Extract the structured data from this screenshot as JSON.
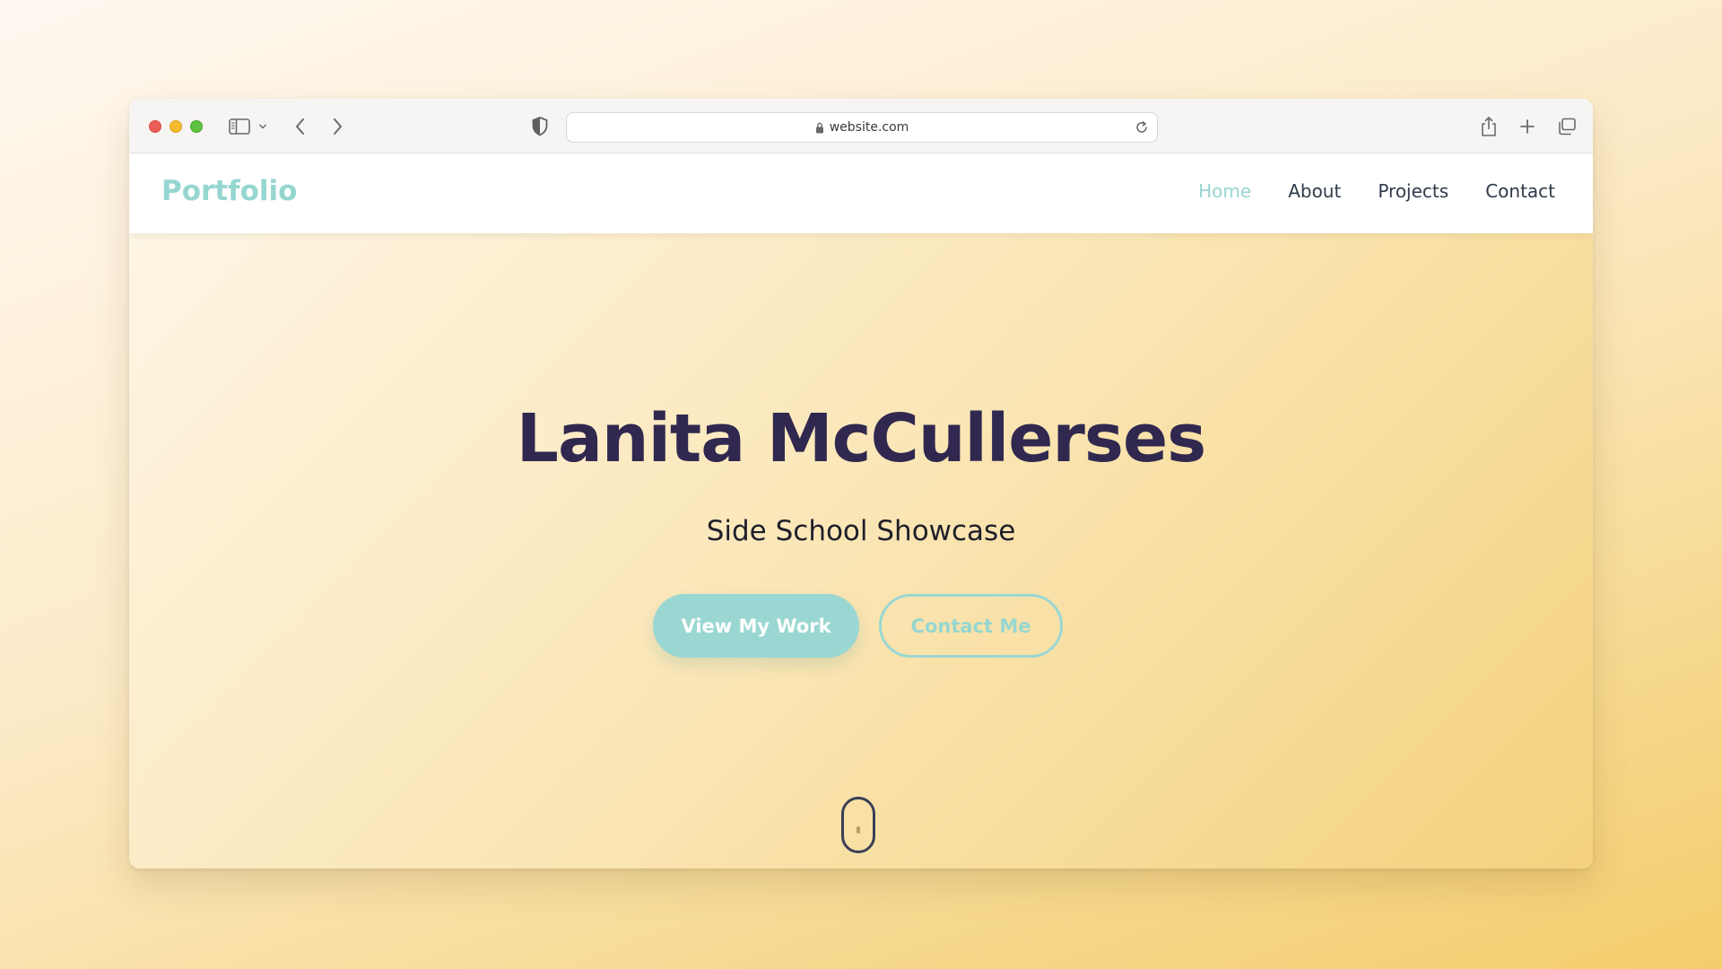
{
  "browser": {
    "url": "website.com",
    "icons": [
      "sidebar-icon",
      "chevron-down-icon",
      "back-arrow-icon",
      "forward-arrow-icon",
      "shield-icon",
      "lock-icon",
      "reload-icon",
      "share-icon",
      "plus-icon",
      "tabs-icon"
    ]
  },
  "site": {
    "logo": "Portfolio",
    "nav": {
      "home": "Home",
      "about": "About",
      "projects": "Projects",
      "contact": "Contact",
      "active": "Home"
    },
    "hero": {
      "title": "Lanita McCullerses",
      "subtitle": "Side School Showcase",
      "primary_button": "View My Work",
      "secondary_button": "Contact Me",
      "scroll_indicator_icon": "mouse-scroll-icon"
    }
  },
  "colors": {
    "accent": "#96d6d0",
    "title": "#30284f",
    "nav_text": "#2f3a4a"
  }
}
